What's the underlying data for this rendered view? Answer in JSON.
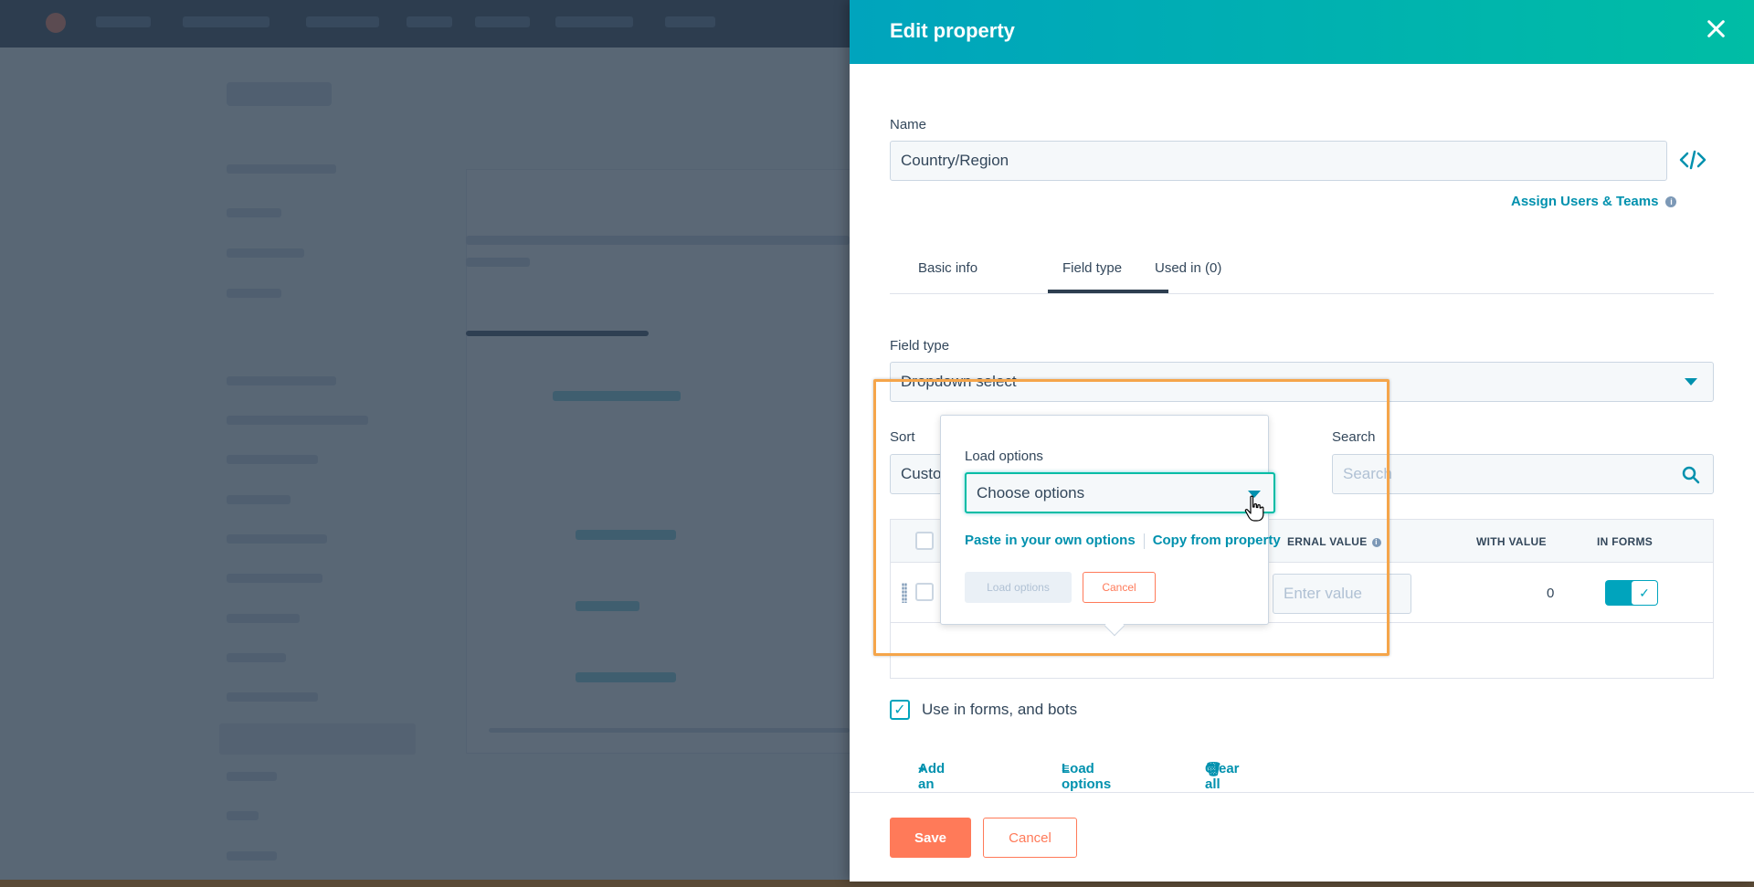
{
  "panel": {
    "title": "Edit property",
    "name_label": "Name",
    "name_value": "Country/Region",
    "assign_link": "Assign Users & Teams",
    "tabs": [
      {
        "label": "Basic info"
      },
      {
        "label": "Field type",
        "active": true
      },
      {
        "label": "Used in (0)"
      }
    ],
    "field_type_label": "Field type",
    "field_type_value": "Dropdown select",
    "sort_label": "Sort",
    "sort_value": "Custo",
    "search_label": "Search",
    "search_placeholder": "Search",
    "table": {
      "headers": {
        "internal_value": "ERNAL VALUE",
        "with_value": "WITH VALUE",
        "in_forms": "IN FORMS"
      },
      "row": {
        "value_placeholder": "Enter value",
        "count": "0",
        "in_forms": true
      },
      "actions": {
        "add": "Add an option",
        "load": "Load options",
        "clear": "Clear all"
      }
    },
    "use_in_forms": {
      "label": "Use in forms, and bots",
      "checked": true
    },
    "footer": {
      "save": "Save",
      "cancel": "Cancel"
    }
  },
  "popover": {
    "label": "Load options",
    "select_value": "Choose options",
    "link_paste": "Paste in your own options",
    "link_copy": "Copy from property",
    "load_button": "Load options",
    "cancel_button": "Cancel"
  },
  "colors": {
    "header_gradient_start": "#00a4bd",
    "header_gradient_end": "#00bda5",
    "primary_orange": "#ff7a59",
    "link_teal": "#0091ae",
    "highlight_box": "#f5a54a"
  },
  "icons": {
    "close": "close-icon",
    "code": "code-icon",
    "info": "info-icon",
    "dropdown": "caret-down-icon",
    "search": "search-icon",
    "drag": "drag-handle-icon",
    "check": "check-icon",
    "plus": "plus-icon",
    "list": "list-icon",
    "trash": "trash-icon",
    "cursor": "hand-cursor-icon"
  }
}
